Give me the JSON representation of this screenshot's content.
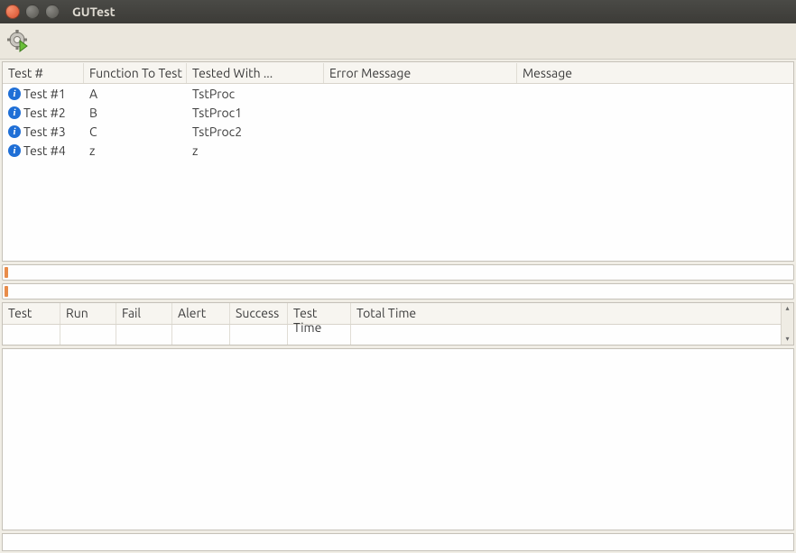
{
  "window": {
    "title": "GUTest"
  },
  "tests_table": {
    "headers": {
      "testnum": "Test #",
      "func": "Function To Test",
      "tested": "Tested With ...",
      "error": "Error Message",
      "msg": "Message"
    },
    "rows": [
      {
        "testnum": "Test #1",
        "func": "A",
        "tested": "TstProc",
        "error": "",
        "msg": ""
      },
      {
        "testnum": "Test #2",
        "func": "B",
        "tested": "TstProc1",
        "error": "",
        "msg": ""
      },
      {
        "testnum": "Test #3",
        "func": "C",
        "tested": "TstProc2",
        "error": "",
        "msg": ""
      },
      {
        "testnum": "Test #4",
        "func": "z",
        "tested": "z",
        "error": "",
        "msg": ""
      }
    ]
  },
  "stats_table": {
    "headers": {
      "test": "Test",
      "run": "Run",
      "fail": "Fail",
      "alert": "Alert",
      "success": "Success",
      "testtime": "Test Time",
      "totaltime": "Total Time"
    },
    "row": {
      "test": "",
      "run": "",
      "fail": "",
      "alert": "",
      "success": "",
      "testtime": "",
      "totaltime": ""
    }
  },
  "icons": {
    "run": "run-tests-icon",
    "info": "info-icon"
  }
}
